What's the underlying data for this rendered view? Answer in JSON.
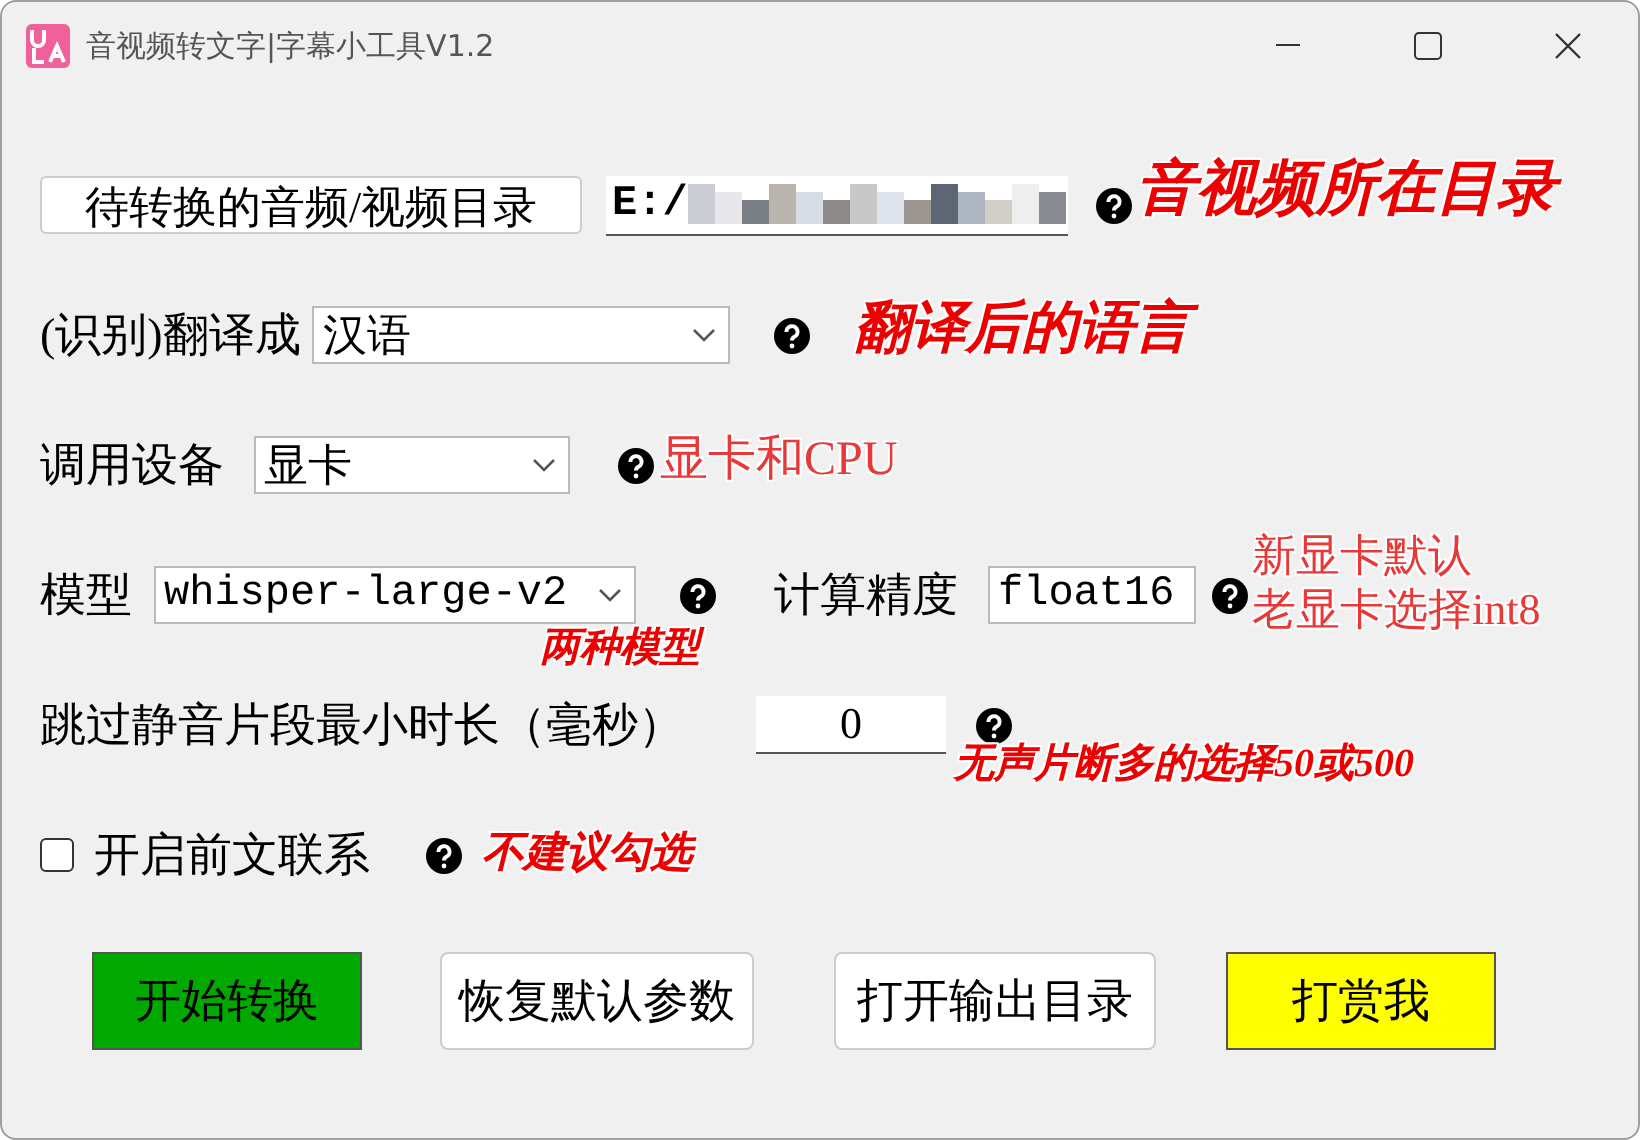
{
  "window": {
    "title": "音视频转文字|字幕小工具V1.2"
  },
  "source": {
    "button": "待转换的音频/视频目录",
    "value": "E:/"
  },
  "language": {
    "label": "(识别)翻译成",
    "value": "汉语"
  },
  "device": {
    "label": "调用设备",
    "value": "显卡"
  },
  "model": {
    "label": "模型",
    "value": "whisper-large-v2"
  },
  "precision": {
    "label": "计算精度",
    "value": "float16"
  },
  "silence": {
    "label": "跳过静音片段最小时长（毫秒）",
    "value": "0"
  },
  "context": {
    "label": "开启前文联系",
    "checked": false
  },
  "annotations": [
    {
      "text": "音视频所在目录",
      "kind": "brush"
    },
    {
      "text": "翻译后的语言",
      "kind": "brush"
    },
    {
      "text": "显卡和CPU",
      "kind": "plain"
    },
    {
      "text": "新显卡默认",
      "kind": "plain"
    },
    {
      "text": "老显卡选择int8",
      "kind": "plain"
    },
    {
      "text": "两种模型",
      "kind": "brush"
    },
    {
      "text": "无声片断多的选择50或500",
      "kind": "brush"
    },
    {
      "text": "不建议勾选",
      "kind": "brush"
    }
  ],
  "buttons": [
    {
      "label": "开始转换",
      "color": "#00a800"
    },
    {
      "label": "恢复默认参数",
      "color": "#ffffff"
    },
    {
      "label": "打开输出目录",
      "color": "#ffffff"
    },
    {
      "label": "打赏我",
      "color": "#ffff00"
    }
  ]
}
